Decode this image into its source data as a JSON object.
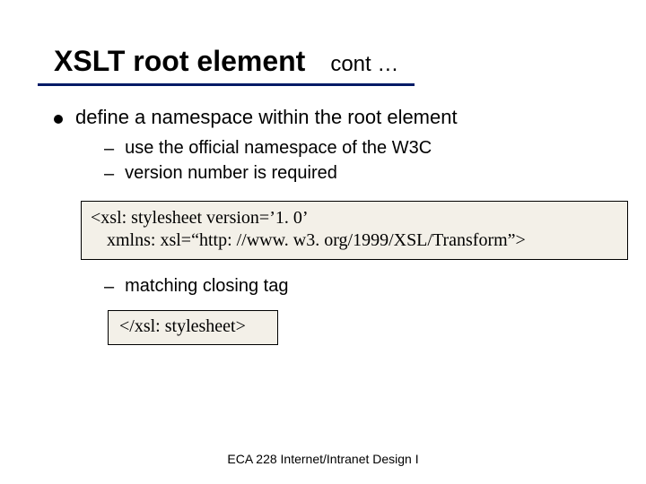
{
  "title": {
    "main": "XSLT root element",
    "cont": "cont …"
  },
  "bullets": {
    "l1_0": "define a namespace within the root element",
    "l2_0": "use the official namespace of the W3C",
    "l2_1": "version number is required",
    "l2_2": "matching closing tag"
  },
  "code": {
    "box1_line1": "<xsl: stylesheet version=’1. 0’",
    "box1_line2": "xmlns: xsl=“http: //www. w3. org/1999/XSL/Transform”>",
    "box2": "</xsl: stylesheet>"
  },
  "footer": "ECA 228  Internet/Intranet Design I"
}
